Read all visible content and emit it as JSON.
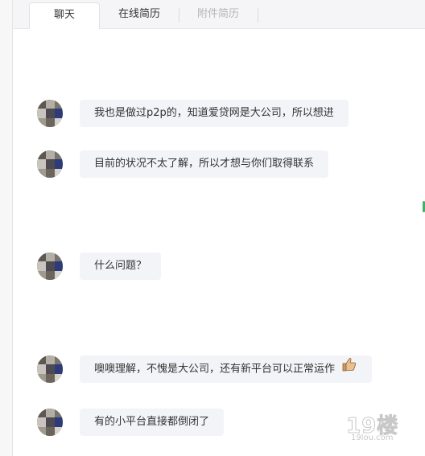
{
  "tabs": [
    {
      "label": "聊天",
      "active": true
    },
    {
      "label": "在线简历",
      "active": false
    },
    {
      "label": "附件简历",
      "active": false,
      "disabled": true
    }
  ],
  "messages": [
    {
      "text": "我也是做过p2p的，知道爱贷网是大公司，所以想进",
      "emoji": null
    },
    {
      "text": "目前的状况不太了解，所以才想与你们取得联系",
      "emoji": null
    },
    {
      "text": "什么问题？",
      "emoji": null
    },
    {
      "text": "噢噢理解，不愧是大公司，还有新平台可以正常运作",
      "emoji": "thumbs-up-icon"
    },
    {
      "text": "有的小平台直接都倒闭了",
      "emoji": null
    }
  ],
  "watermark": {
    "big": "19楼",
    "small": "19lou.com"
  },
  "colors": {
    "bubble": "#f3f4f8",
    "scroll_indicator": "#3ab36a"
  }
}
